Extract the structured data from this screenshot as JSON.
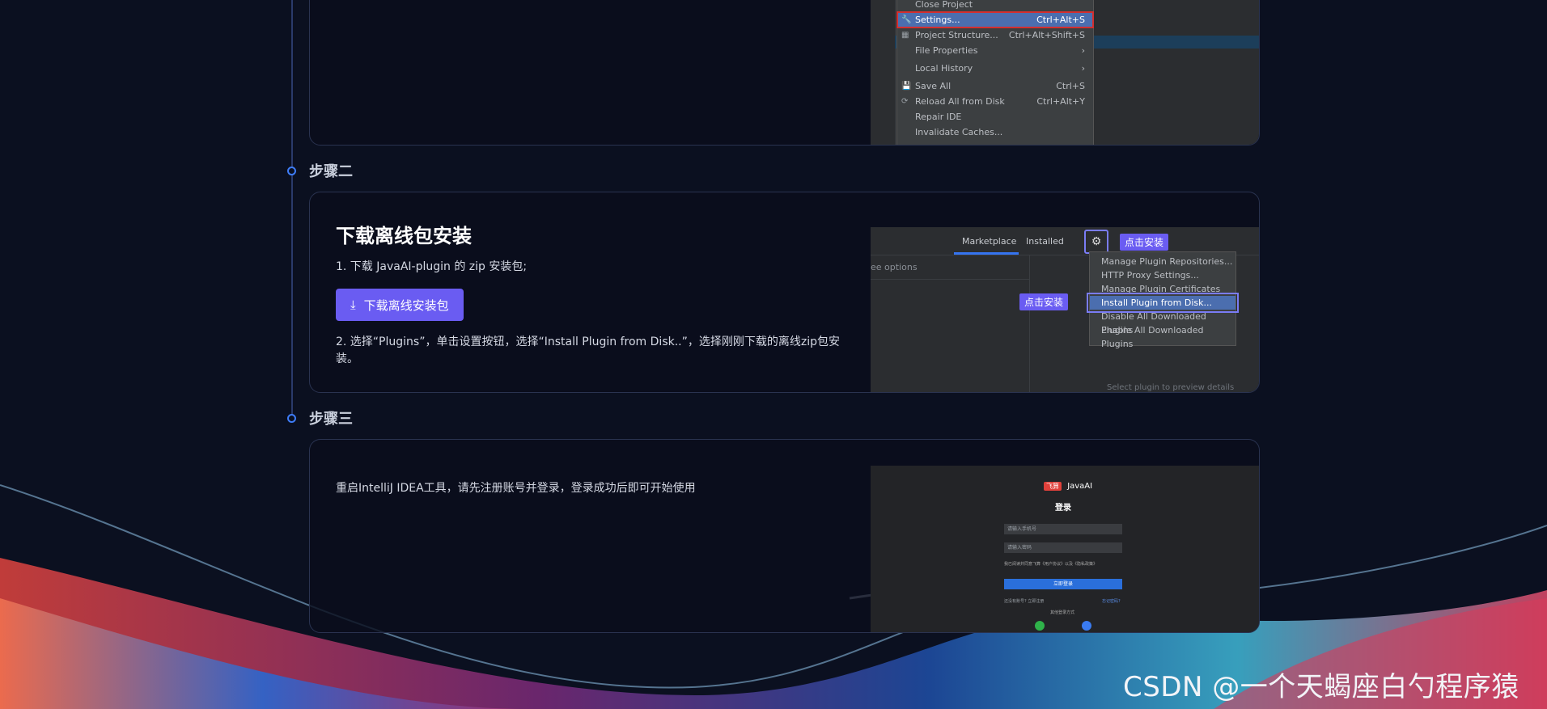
{
  "steps": [
    {
      "label": ""
    },
    {
      "label": "步骤二",
      "title": "下载离线包安装",
      "text1": "1. 下载 JavaAI-plugin 的 zip 安装包;",
      "button": "下载离线安装包",
      "text2": "2. 选择“Plugins”，单击设置按钮，选择“Install Plugin from Disk..”，选择刚刚下载的离线zip包安装。"
    },
    {
      "label": "步骤三",
      "text": "重启IntelliJ IDEA工具，请先注册账号并登录，登录成功后即可开始使用"
    }
  ],
  "menu1": [
    {
      "label": "Close Project",
      "shortcut": "",
      "icon": ""
    },
    {
      "label": "Settings...",
      "shortcut": "Ctrl+Alt+S",
      "icon": "wrench-icon",
      "highlight": true
    },
    {
      "label": "Project Structure...",
      "shortcut": "Ctrl+Alt+Shift+S",
      "icon": "structure-icon"
    },
    {
      "label": "File Properties",
      "shortcut": "›",
      "icon": ""
    },
    {
      "label": "Local History",
      "shortcut": "›",
      "icon": ""
    },
    {
      "label": "Save All",
      "shortcut": "Ctrl+S",
      "icon": "save-icon"
    },
    {
      "label": "Reload All from Disk",
      "shortcut": "Ctrl+Alt+Y",
      "icon": "reload-icon"
    },
    {
      "label": "Repair IDE",
      "shortcut": "",
      "icon": ""
    },
    {
      "label": "Invalidate Caches...",
      "shortcut": "",
      "icon": ""
    }
  ],
  "plugins": {
    "tab_marketplace": "Marketplace",
    "tab_installed": "Installed",
    "search_hint": "ee options",
    "callout": "点击安装",
    "preview_hint": "Select plugin to preview details",
    "menu": [
      "Manage Plugin Repositories...",
      "HTTP Proxy Settings...",
      "Manage Plugin Certificates",
      "Install Plugin from Disk...",
      "Disable All Downloaded Plugins",
      "Enable All Downloaded Plugins"
    ]
  },
  "login": {
    "brand": "JavaAI",
    "badge": "飞算",
    "title": "登录",
    "phone_placeholder": "请输入手机号",
    "password_placeholder": "请输入密码",
    "agree": "我已阅读并同意飞算《用户协议》以及《隐私政策》",
    "login_button": "立即登录",
    "register": "还没有账号? 立即注册",
    "forgot": "忘记密码?",
    "other": "其他登录方式"
  },
  "watermark": "CSDN @一个天蝎座白勺程序猿",
  "colors": {
    "accent": "#6a5cf2",
    "timeline": "#3e7cf7",
    "highlight_red": "#d32f2f"
  }
}
